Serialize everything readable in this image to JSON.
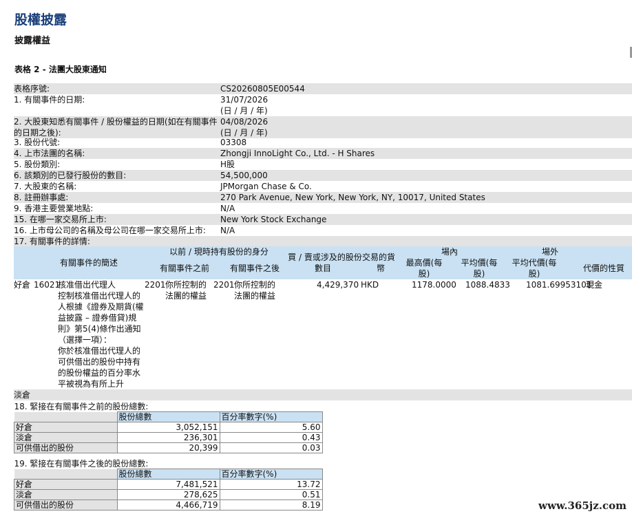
{
  "header": {
    "title": "股權披露",
    "subtitle": "披露權益",
    "form_title": "表格 2 - 法團大股東通知"
  },
  "fields": [
    {
      "label": "表格序號:",
      "value": "CS20260805E00544"
    },
    {
      "label": "1. 有關事件的日期:",
      "value": "31/07/2026",
      "value2": "(日 / 月 / 年)"
    },
    {
      "label": "2. 大股東知悉有關事件 / 股份權益的日期(如在有關事件",
      "label2": "的日期之後):",
      "value": "04/08/2026",
      "value2": "(日 / 月 / 年)"
    },
    {
      "label": "3. 股份代號:",
      "value": "03308"
    },
    {
      "label": "4. 上市法團的名稱:",
      "value": "Zhongji InnoLight Co., Ltd. - H Shares"
    },
    {
      "label": "5. 股份類別:",
      "value": "H股"
    },
    {
      "label": "6. 該類別的已發行股份的數目:",
      "value": "54,500,000"
    },
    {
      "label": "7. 大股東的名稱:",
      "value": "JPMorgan Chase & Co."
    },
    {
      "label": "8. 註冊辦事處:",
      "value": "270 Park Avenue, New York, New York, NY, 10017, United States"
    },
    {
      "label": "9. 香港主要營業地點:",
      "value": "N/A"
    },
    {
      "label": "15. 在哪一家交易所上市:",
      "value": "New York Stock Exchange"
    },
    {
      "label": "16. 上市母公司的名稱及母公司在哪一家交易所上市:",
      "value": "N/A"
    },
    {
      "label": "17. 有關事件的詳情:"
    }
  ],
  "event_table": {
    "headers": {
      "code_desc": "有關事件的簡述",
      "capacity": "以前 / 現時持有股份的身分",
      "before": "有關事件之前",
      "after": "有關事件之後",
      "shares1": "買 / 賣或涉及的股份",
      "shares2": "數目",
      "currency1": "交易的貨",
      "currency2": "幣",
      "onex": "場內",
      "high1": "最高價(每",
      "high2": "股)",
      "avg1": "平均價(每",
      "avg2": "股)",
      "offex": "場外",
      "offavg1": "平均代價(每",
      "offavg2": "股)",
      "nature": "代價的性質"
    },
    "row": {
      "position": "好倉",
      "code": "16021",
      "desc_lines": [
        "核准借出代理人",
        "控制核准借出代理人的",
        "人根據《證券及期貨(權",
        "益披露 – 證券借貸)規",
        "則》第5(4)條作出通知",
        "（選擇一項）：",
        "你於核准借出代理人的",
        "可供借出的股份中持有",
        "的股份權益的百分率水",
        "平被視為有所上升"
      ],
      "before_code": "2201",
      "before_l1": "你所控制的",
      "before_l2": "法團的權益",
      "after_code": "2201",
      "after_l1": "你所控制的",
      "after_l2": "法團的權益",
      "shares": "4,429,370",
      "currency": "HKD",
      "high": "1178.0000",
      "avg": "1088.4833",
      "offavg": "1081.69953101",
      "nature": "現金"
    },
    "short_label": "淡倉"
  },
  "section18": {
    "title": "18. 緊接在有關事件之前的股份總數:",
    "col1": "股份總數",
    "col2": "百分率數字(%)",
    "rows": [
      {
        "label": "好倉",
        "shares": "3,052,151",
        "pct": "5.60"
      },
      {
        "label": "淡倉",
        "shares": "236,301",
        "pct": "0.43"
      },
      {
        "label": "可供借出的股份",
        "shares": "20,399",
        "pct": "0.03"
      }
    ]
  },
  "section19": {
    "title": "19. 緊接在有關事件之後的股份總數:",
    "col1": "股份總數",
    "col2": "百分率數字(%)",
    "rows": [
      {
        "label": "好倉",
        "shares": "7,481,521",
        "pct": "13.72"
      },
      {
        "label": "淡倉",
        "shares": "278,625",
        "pct": "0.51"
      },
      {
        "label": "可供借出的股份",
        "shares": "4,466,719",
        "pct": "8.19"
      }
    ]
  },
  "watermark": "www.365jz.com",
  "colors": {
    "title": "#1a3f7a",
    "header_bg": "#c9e1f3",
    "shade": "#e3e3e3"
  }
}
